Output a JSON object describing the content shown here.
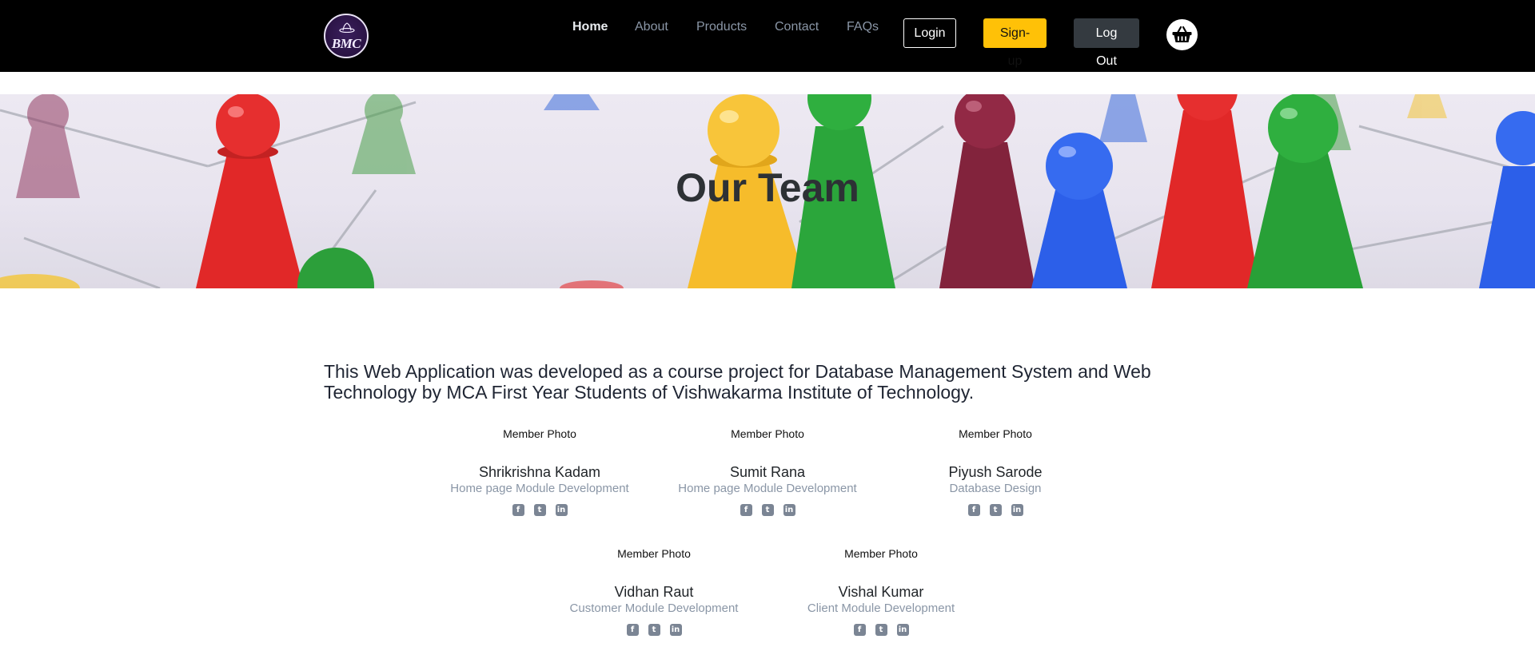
{
  "nav": {
    "logo_text": "BMC",
    "links": [
      "Home",
      "About",
      "Products",
      "Contact",
      "FAQs"
    ],
    "login": "Login",
    "signup": "Sign-up",
    "logout": "Log Out",
    "cart_icon": "basket-icon"
  },
  "hero": {
    "title": "Our Team"
  },
  "intro": "This Web Application was developed as a course project for Database Management System and Web Technology by MCA First Year Students of Vishwakarma Institute of Technology.",
  "members": [
    {
      "photo": "Member Photo",
      "name": "Shrikrishna Kadam",
      "role": "Home page Module Development"
    },
    {
      "photo": "Member Photo",
      "name": "Sumit Rana",
      "role": "Home page Module Development"
    },
    {
      "photo": "Member Photo",
      "name": "Piyush Sarode",
      "role": "Database Design"
    },
    {
      "photo": "Member Photo",
      "name": "Vidhan Raut",
      "role": "Customer Module Development"
    },
    {
      "photo": "Member Photo",
      "name": "Vishal Kumar",
      "role": "Client Module Development"
    }
  ],
  "social_icons": [
    "facebook-icon",
    "twitter-icon",
    "linkedin-icon"
  ],
  "colors": {
    "navbar_bg": "#000000",
    "signup_bg": "#ffc107",
    "logout_bg": "#343a40",
    "muted_text": "#8a96a6"
  }
}
